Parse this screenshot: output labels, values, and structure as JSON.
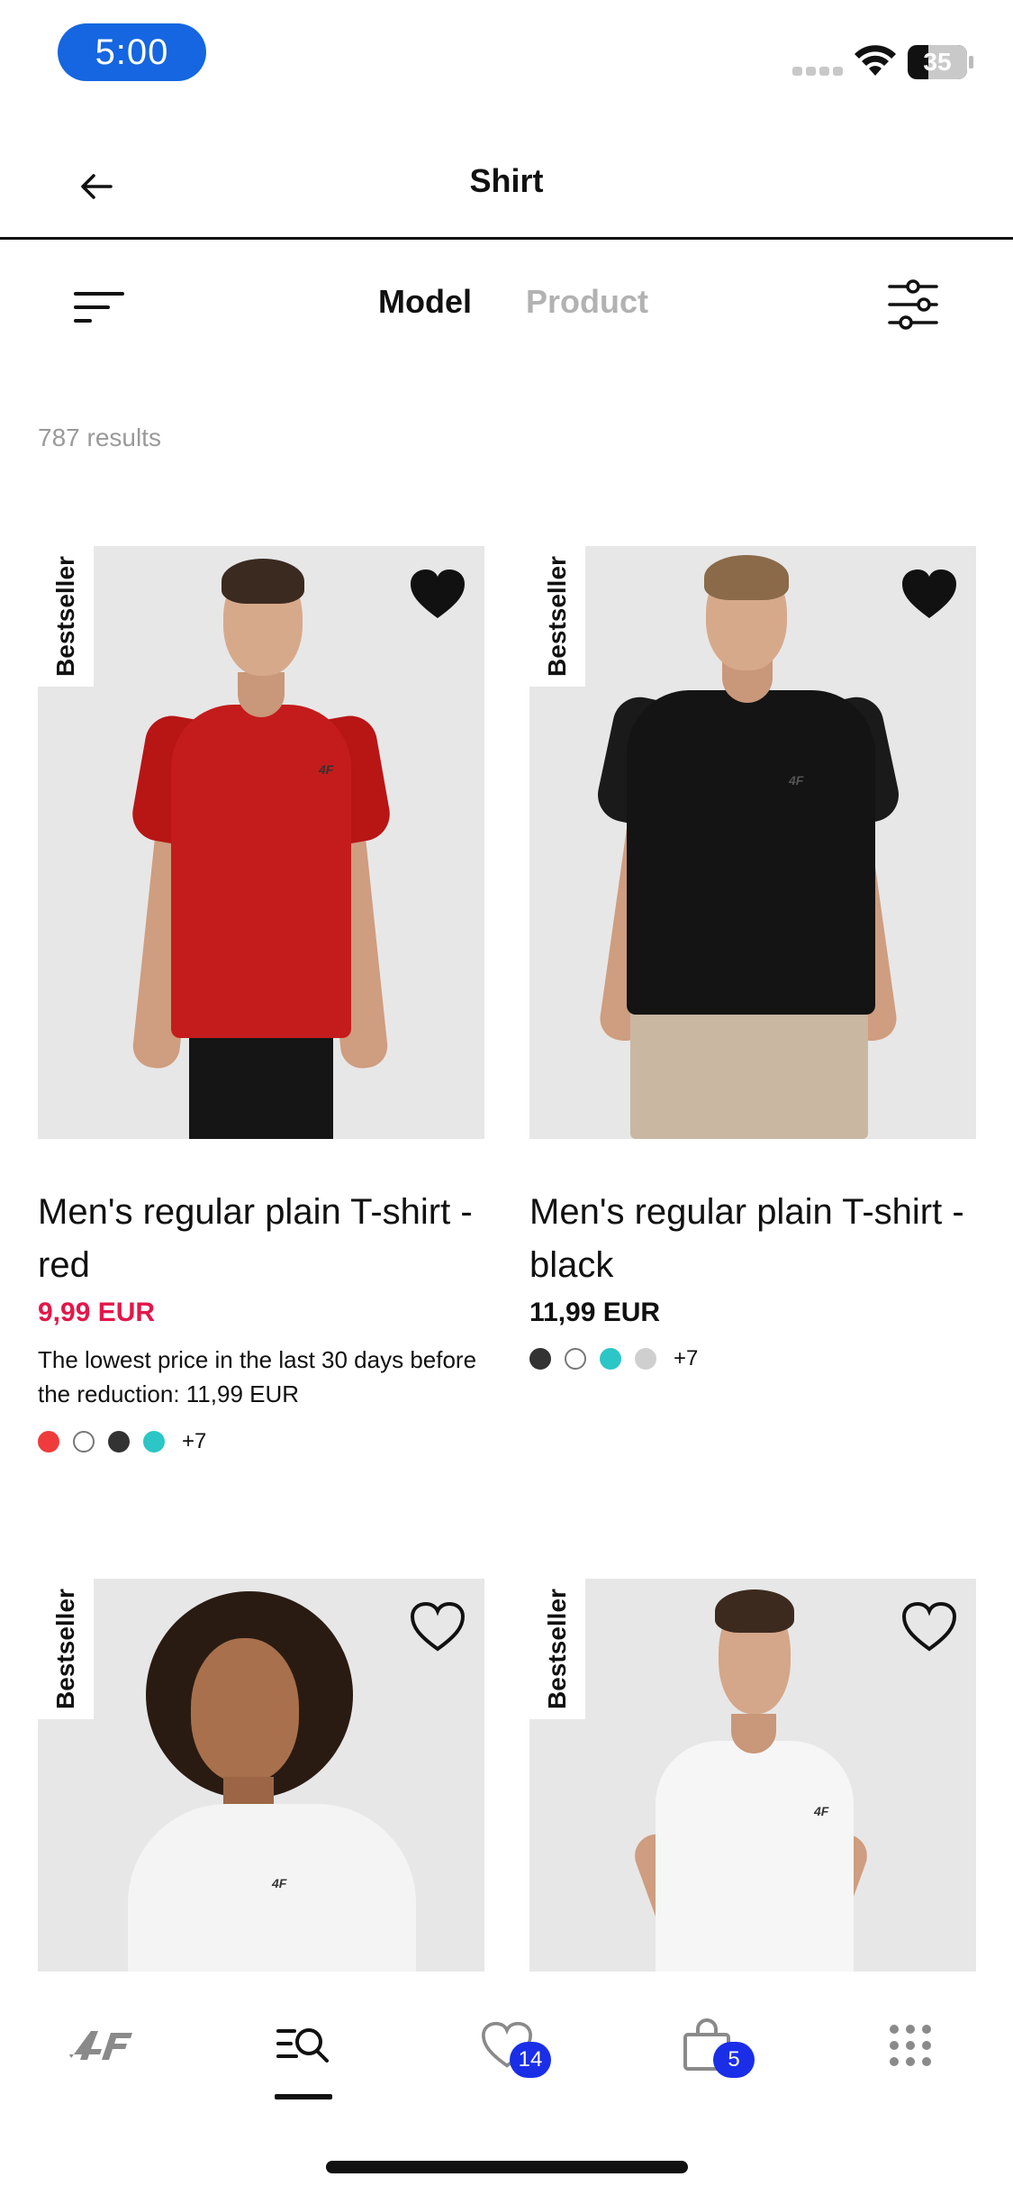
{
  "status_bar": {
    "time": "5:00",
    "battery": "35",
    "battery_level": 0.35
  },
  "header": {
    "title": "Shirt",
    "back_icon": "arrow-left-icon"
  },
  "toolbar": {
    "sort_icon": "sort-lines-icon",
    "tabs": [
      {
        "label": "Model",
        "active": true
      },
      {
        "label": "Product",
        "active": false
      }
    ],
    "filter_icon": "sliders-icon"
  },
  "results": {
    "count_text": "787 results"
  },
  "products": [
    {
      "badge": "Bestseller",
      "favorite": true,
      "title": "Men's regular plain T-shirt - red",
      "price": "9,99 EUR",
      "on_sale": true,
      "price_note": "The lowest price in the last 30 days before the reduction: 11,99 EUR",
      "swatches": [
        "#ef3b3b",
        "#ffffff",
        "#333333",
        "#2cc6c6"
      ],
      "more_colors": "+7"
    },
    {
      "badge": "Bestseller",
      "favorite": true,
      "title": "Men's regular plain T-shirt - black",
      "price": "11,99 EUR",
      "on_sale": false,
      "swatches": [
        "#333333",
        "#ffffff",
        "#2cc6c6",
        "#cfcfcf"
      ],
      "more_colors": "+7"
    },
    {
      "badge": "Bestseller",
      "favorite": false
    },
    {
      "badge": "Bestseller",
      "favorite": false
    }
  ],
  "bottom_nav": {
    "items": [
      {
        "icon": "4f-logo-icon"
      },
      {
        "icon": "search-catalog-icon",
        "active": true
      },
      {
        "icon": "heart-icon",
        "badge": "14"
      },
      {
        "icon": "shopping-bag-icon",
        "badge": "5"
      },
      {
        "icon": "grid-menu-icon"
      }
    ]
  },
  "colors": {
    "accent": "#1566e0",
    "sale": "#e2174a",
    "badge_blue": "#1a2ee8"
  }
}
